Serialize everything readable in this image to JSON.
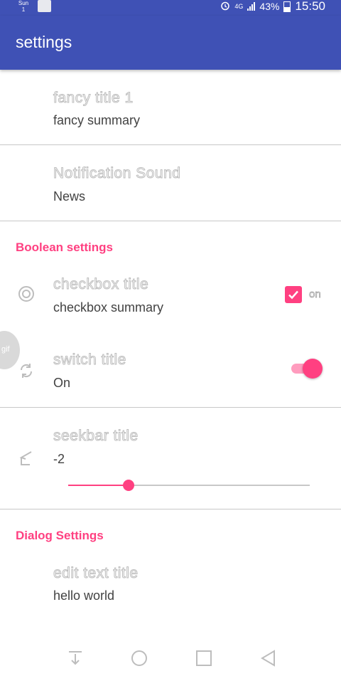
{
  "status_bar": {
    "day": "Sun",
    "date": "1",
    "network": "4G",
    "battery": "43%",
    "time": "15:50"
  },
  "app_bar": {
    "title": "settings"
  },
  "prefs": [
    {
      "title": "fancy title 1",
      "summary": "fancy summary"
    },
    {
      "title": "Notification Sound",
      "summary": "News"
    }
  ],
  "boolean_category": "Boolean settings",
  "checkbox_pref": {
    "title": "checkbox title",
    "summary": "checkbox summary",
    "state_label": "on",
    "checked": true
  },
  "switch_pref": {
    "title": "switch title",
    "summary": "On",
    "on": true
  },
  "seekbar_pref": {
    "title": "seekbar title",
    "value": "-2",
    "fraction": 0.25
  },
  "dialog_category": "Dialog Settings",
  "edit_text_pref": {
    "title": "edit text title",
    "summary": "hello world"
  },
  "floating_bubble": {
    "label": "gif"
  },
  "colors": {
    "primary": "#3f51b5",
    "accent": "#ff4081"
  },
  "nav_bar": {
    "buttons": [
      "recent-apps",
      "home",
      "overview",
      "back"
    ]
  }
}
